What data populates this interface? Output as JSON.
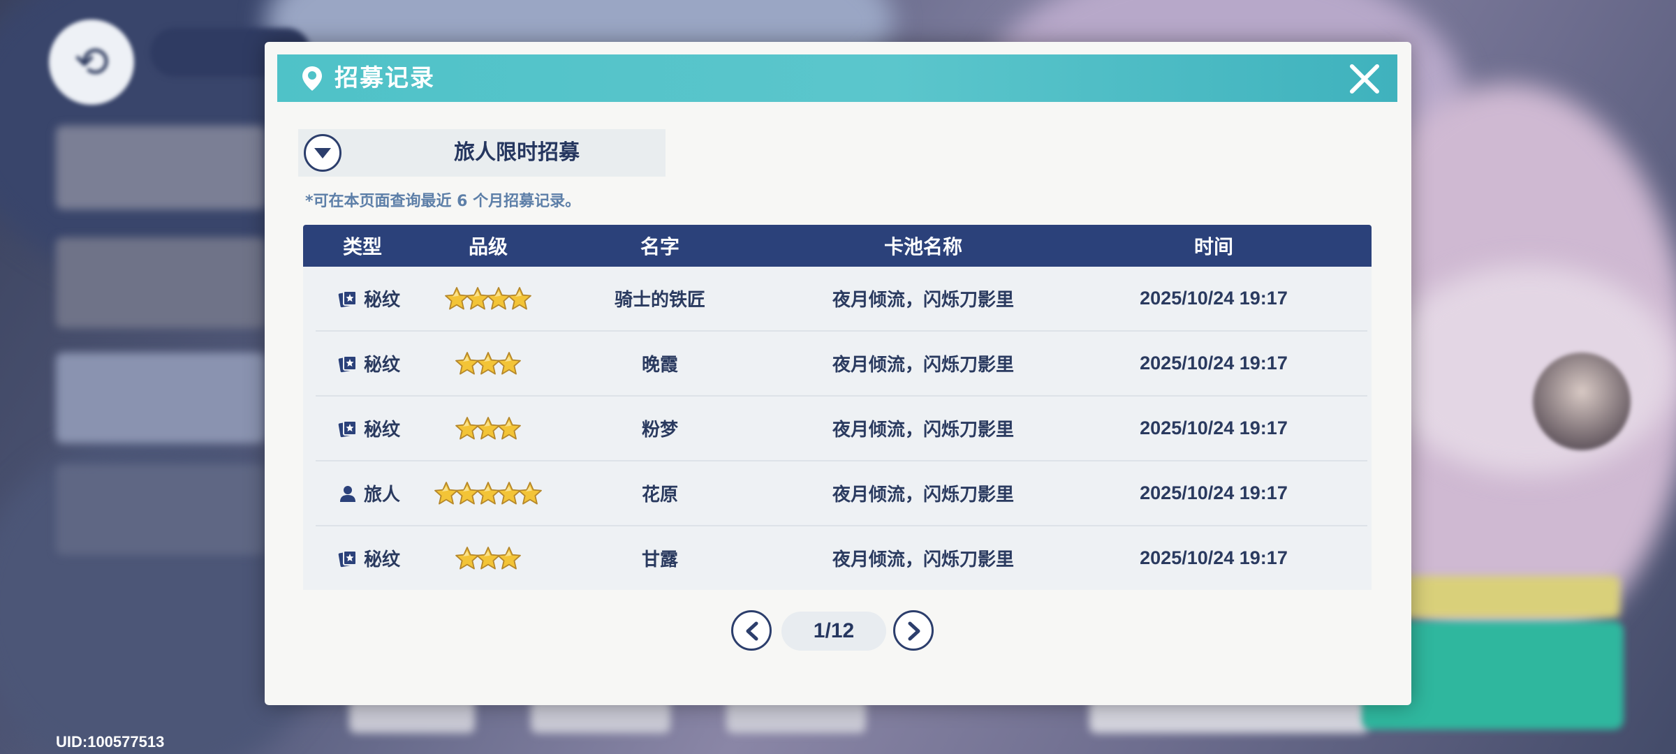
{
  "background": {
    "uid": "UID:100577513"
  },
  "modal": {
    "title": "招募记录",
    "dropdown_label": "旅人限时招募",
    "note": "*可在本页面查询最近 6 个月招募记录。",
    "columns": [
      "类型",
      "品级",
      "名字",
      "卡池名称",
      "时间"
    ],
    "rows": [
      {
        "type": "秘纹",
        "type_icon": "card-icon",
        "stars": 4,
        "name": "骑士的铁匠",
        "pool": "夜月倾流，闪烁刀影里",
        "time": "2025/10/24 19:17"
      },
      {
        "type": "秘纹",
        "type_icon": "card-icon",
        "stars": 3,
        "name": "晚霞",
        "pool": "夜月倾流，闪烁刀影里",
        "time": "2025/10/24 19:17"
      },
      {
        "type": "秘纹",
        "type_icon": "card-icon",
        "stars": 3,
        "name": "粉梦",
        "pool": "夜月倾流，闪烁刀影里",
        "time": "2025/10/24 19:17"
      },
      {
        "type": "旅人",
        "type_icon": "person-icon",
        "stars": 5,
        "name": "花原",
        "pool": "夜月倾流，闪烁刀影里",
        "time": "2025/10/24 19:17"
      },
      {
        "type": "秘纹",
        "type_icon": "card-icon",
        "stars": 3,
        "name": "甘露",
        "pool": "夜月倾流，闪烁刀影里",
        "time": "2025/10/24 19:17"
      }
    ],
    "pagination": "1/12"
  },
  "colors": {
    "header": "#4fc2c8",
    "table_header": "#2b417a",
    "text_dark": "#2a3a5f",
    "star": "#f3c437"
  }
}
